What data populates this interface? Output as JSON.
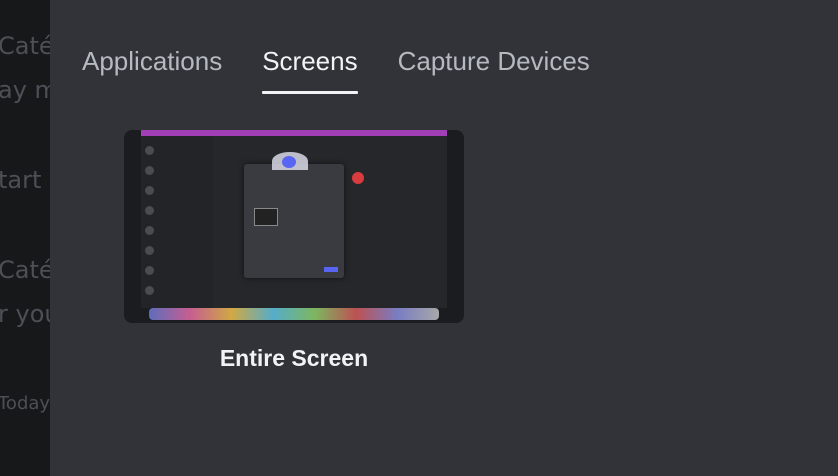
{
  "background_app": {
    "lines": [
      "Caté",
      "ay m",
      "tart",
      "Caté",
      "r you",
      "Today"
    ]
  },
  "tabs": [
    {
      "label": "Applications",
      "active": false
    },
    {
      "label": "Screens",
      "active": true
    },
    {
      "label": "Capture Devices",
      "active": false
    }
  ],
  "sources": [
    {
      "label": "Entire Screen"
    }
  ],
  "colors": {
    "modal_bg": "#313338",
    "active_tab": "#f2f3f5",
    "inactive_tab": "#b5bac1",
    "accent": "#5865f2"
  }
}
